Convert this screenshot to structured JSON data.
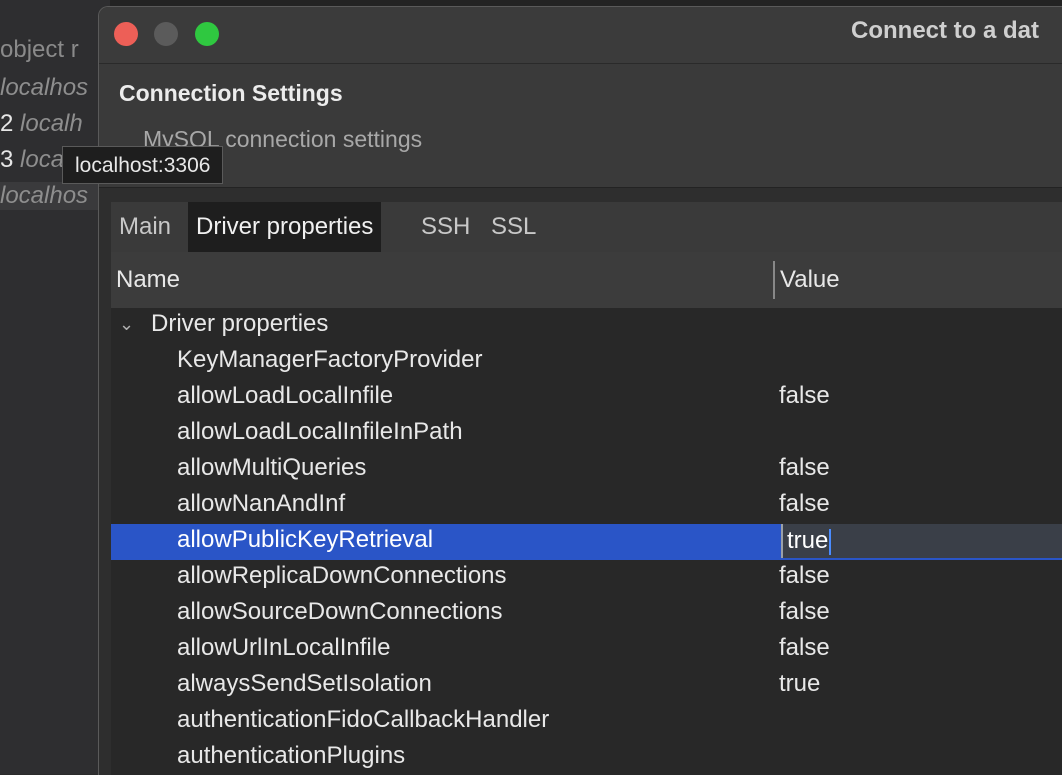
{
  "background_app": {
    "lines": [
      "object r",
      "localhos",
      "2",
      "localh",
      "3",
      "loca",
      "localhos"
    ]
  },
  "window": {
    "title": "Connect to a dat",
    "traffic_lights": [
      "close",
      "minimize",
      "zoom"
    ]
  },
  "header": {
    "title": "Connection Settings",
    "subtitle": "MySQL connection settings"
  },
  "tooltip": "localhost:3306",
  "tabs": [
    {
      "label": "Main",
      "active": false
    },
    {
      "label": "Driver properties",
      "active": true
    },
    {
      "label": "SSH",
      "active": false
    },
    {
      "label": "SSL",
      "active": false
    }
  ],
  "table": {
    "columns": [
      "Name",
      "Value"
    ],
    "group": "Driver properties",
    "rows": [
      {
        "name": "KeyManagerFactoryProvider",
        "value": ""
      },
      {
        "name": "allowLoadLocalInfile",
        "value": "false"
      },
      {
        "name": "allowLoadLocalInfileInPath",
        "value": ""
      },
      {
        "name": "allowMultiQueries",
        "value": "false"
      },
      {
        "name": "allowNanAndInf",
        "value": "false"
      },
      {
        "name": "allowPublicKeyRetrieval",
        "value": "true",
        "selected": true
      },
      {
        "name": "allowReplicaDownConnections",
        "value": "false"
      },
      {
        "name": "allowSourceDownConnections",
        "value": "false"
      },
      {
        "name": "allowUrlInLocalInfile",
        "value": "false"
      },
      {
        "name": "alwaysSendSetIsolation",
        "value": "true"
      },
      {
        "name": "authenticationFidoCallbackHandler",
        "value": ""
      },
      {
        "name": "authenticationPlugins",
        "value": ""
      }
    ]
  },
  "colors": {
    "selection": "#2a55c7",
    "close": "#ed5f57",
    "zoom": "#2fc840"
  }
}
